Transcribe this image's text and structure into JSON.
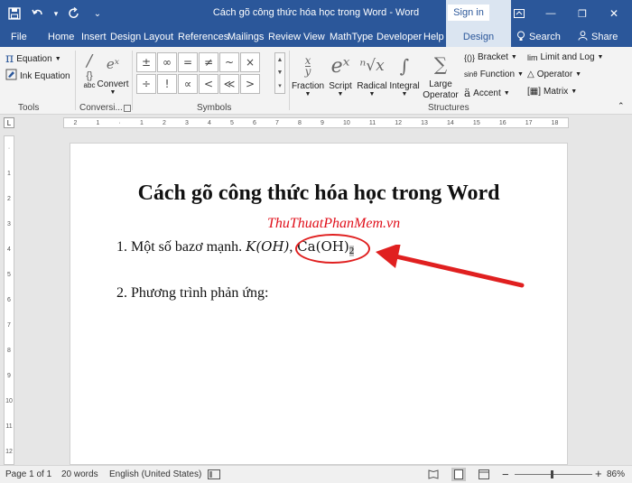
{
  "window": {
    "title": "Cách gõ công thức hóa học trong Word  -  Word",
    "signin_label": "Sign in",
    "min_glyph": "—",
    "restore_glyph": "❐",
    "close_glyph": "✕"
  },
  "qat": {
    "save_glyph": "💾",
    "undo_glyph": "↶",
    "undo_drop": "▾",
    "redo_glyph": "↻",
    "customize_glyph": "⌄"
  },
  "tabs": [
    "File",
    "Home",
    "Insert",
    "Design",
    "Layout",
    "References",
    "Mailings",
    "Review",
    "View",
    "MathType",
    "Developer",
    "Help",
    "Design"
  ],
  "search_label": "Search",
  "share_label": "Share",
  "ribbon": {
    "equation_label": "Equation",
    "ink_equation_label": "Ink Equation",
    "convert_label": "Convert",
    "convert_sub": "abc",
    "tools_group": "Tools",
    "conversions_group": "Conversi...",
    "symbols_group": "Symbols",
    "structures_group": "Structures",
    "symbols": [
      "±",
      "∞",
      "=",
      "≠",
      "~",
      "×",
      "÷",
      "!",
      "∝",
      "<",
      "≪",
      ">"
    ],
    "fraction_label": "Fraction",
    "script_label": "Script",
    "radical_label": "Radical",
    "integral_label": "Integral",
    "large_operator_label": "Large\nOperator",
    "bracket_label": "Bracket",
    "function_label": "Function",
    "accent_label": "Accent",
    "limit_log_label": "Limit and Log",
    "operator_label": "Operator",
    "matrix_label": "Matrix"
  },
  "document": {
    "heading": "Cách gõ công thức hóa học trong Word",
    "watermark": "ThuThuatPhanMem.vn",
    "line1_prefix": "1. Một số bazơ mạnh. ",
    "line1_math_a": "K(OH)",
    "line1_sep": ",",
    "line1_math_b": " Ca(OH)",
    "line1_sub": "2",
    "line2": "2. Phương trình phản ứng:"
  },
  "ruler": {
    "h_marks": [
      "2",
      "1",
      "·",
      "1",
      "2",
      "3",
      "4",
      "5",
      "6",
      "7",
      "8",
      "9",
      "10",
      "11",
      "12",
      "13",
      "14",
      "15",
      "16",
      "17",
      "18"
    ],
    "v_marks": [
      "·",
      "1",
      "2",
      "3",
      "4",
      "5",
      "6",
      "7",
      "8",
      "9",
      "10",
      "11",
      "12"
    ]
  },
  "status": {
    "page": "Page 1 of 1",
    "words": "20 words",
    "language": "English (United States)",
    "zoom": "86%"
  },
  "colors": {
    "accent": "#2b579a",
    "annotation": "#e02020"
  }
}
